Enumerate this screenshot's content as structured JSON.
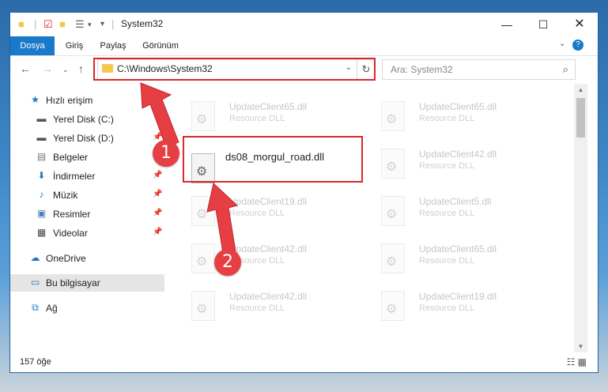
{
  "window": {
    "title": "System32",
    "minimize_icon": "minimize-icon",
    "maximize_icon": "maximize-icon",
    "close_icon": "close-icon"
  },
  "ribbon": {
    "tabs": [
      {
        "label": "Dosya",
        "active": true
      },
      {
        "label": "Giriş"
      },
      {
        "label": "Paylaş"
      },
      {
        "label": "Görünüm"
      }
    ]
  },
  "address": {
    "path": "C:\\Windows\\System32",
    "search_placeholder": "Ara: System32"
  },
  "sidebar": {
    "items": [
      {
        "label": "Hızlı erişim",
        "icon": "star-icon"
      },
      {
        "label": "Yerel Disk (C:)",
        "icon": "drive-icon"
      },
      {
        "label": "Yerel Disk (D:)",
        "icon": "drive-icon"
      },
      {
        "label": "Belgeler",
        "icon": "documents-icon"
      },
      {
        "label": "İndirmeler",
        "icon": "download-icon"
      },
      {
        "label": "Müzik",
        "icon": "music-icon"
      },
      {
        "label": "Resimler",
        "icon": "pictures-icon"
      },
      {
        "label": "Videolar",
        "icon": "video-icon"
      },
      {
        "label": "OneDrive",
        "icon": "cloud-icon"
      },
      {
        "label": "Bu bilgisayar",
        "icon": "computer-icon"
      },
      {
        "label": "Ağ",
        "icon": "network-icon"
      }
    ]
  },
  "files": {
    "featured": "ds08_morgul_road.dll",
    "type_label": "Resource DLL",
    "tiles": [
      "UpdateClient65.dll",
      "UpdateClient65.dll",
      "UpdateClient42.dll",
      "UpdateClient19.dll",
      "UpdateClient5.dll",
      "UpdateClient42.dll",
      "UpdateClient65.dll",
      "UpdateClient42.dll",
      "UpdateClient19.dll"
    ]
  },
  "status": {
    "item_count": "157 öğe"
  },
  "callouts": [
    "1",
    "2"
  ],
  "colors": {
    "accent": "#1979ca",
    "highlight": "#d9282f",
    "callout": "#e53e43"
  }
}
